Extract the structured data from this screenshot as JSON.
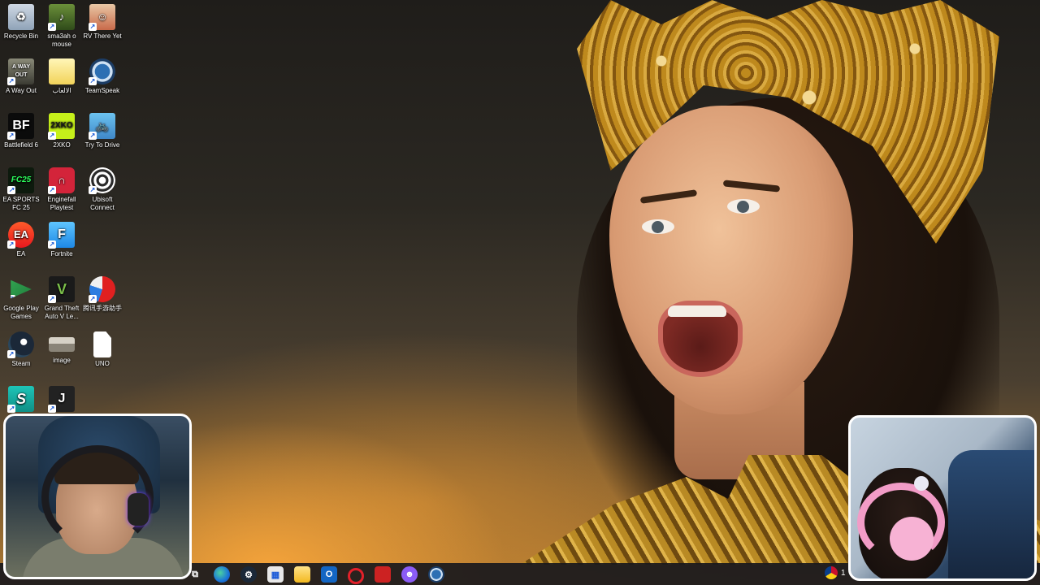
{
  "desktop": {
    "icons": [
      {
        "label": "Recycle Bin",
        "icon": "recycle-bin-icon"
      },
      {
        "label": "sma3ah o mouse",
        "icon": "shortcut-app-icon"
      },
      {
        "label": "RV There Yet",
        "icon": "rv-there-yet-icon"
      },
      {
        "label": "A Way Out",
        "icon": "a-way-out-icon"
      },
      {
        "label": "الالعاب",
        "icon": "folder-icon"
      },
      {
        "label": "TeamSpeak",
        "icon": "teamspeak-icon"
      },
      {
        "label": "Battlefield 6",
        "icon": "battlefield-icon"
      },
      {
        "label": "2XKO",
        "icon": "2xko-icon"
      },
      {
        "label": "Try To Drive",
        "icon": "try-to-drive-icon"
      },
      {
        "label": "EA SPORTS FC 25",
        "icon": "ea-sports-fc-icon"
      },
      {
        "label": "Enginefall Playtest",
        "icon": "enginefall-icon"
      },
      {
        "label": "Ubisoft Connect",
        "icon": "ubisoft-connect-icon"
      },
      {
        "label": "EA",
        "icon": "ea-icon"
      },
      {
        "label": "Fortnite",
        "icon": "fortnite-icon"
      },
      {
        "label": "Google Play Games",
        "icon": "google-play-games-icon"
      },
      {
        "label": "Grand Theft Auto V Le...",
        "icon": "gta-v-icon"
      },
      {
        "label": "腾讯手游助手",
        "icon": "tencent-gaming-buddy-icon"
      },
      {
        "label": "Steam",
        "icon": "steam-icon"
      },
      {
        "label": "image",
        "icon": "image-file-icon"
      },
      {
        "label": "UNO",
        "icon": "uno-file-icon"
      },
      {
        "label": "",
        "icon": "surfshark-icon"
      },
      {
        "label": "",
        "icon": "jackbox-icon"
      }
    ]
  },
  "taskbar": {
    "apps": [
      {
        "name": "task-view",
        "icon": "task-view-icon"
      },
      {
        "name": "edge",
        "icon": "edge-icon"
      },
      {
        "name": "steam",
        "icon": "steam-icon"
      },
      {
        "name": "store",
        "icon": "store-icon"
      },
      {
        "name": "file-explorer",
        "icon": "folder-icon"
      },
      {
        "name": "outlook",
        "icon": "outlook-icon"
      },
      {
        "name": "opera",
        "icon": "opera-icon"
      },
      {
        "name": "medal",
        "icon": "medal-icon"
      },
      {
        "name": "discord",
        "icon": "discord-icon"
      },
      {
        "name": "teamspeak",
        "icon": "teamspeak-icon"
      }
    ],
    "clock_partial": "1"
  },
  "colors": {
    "taskbar_bg": "#18181c",
    "webcam_border": "#ffffff"
  }
}
